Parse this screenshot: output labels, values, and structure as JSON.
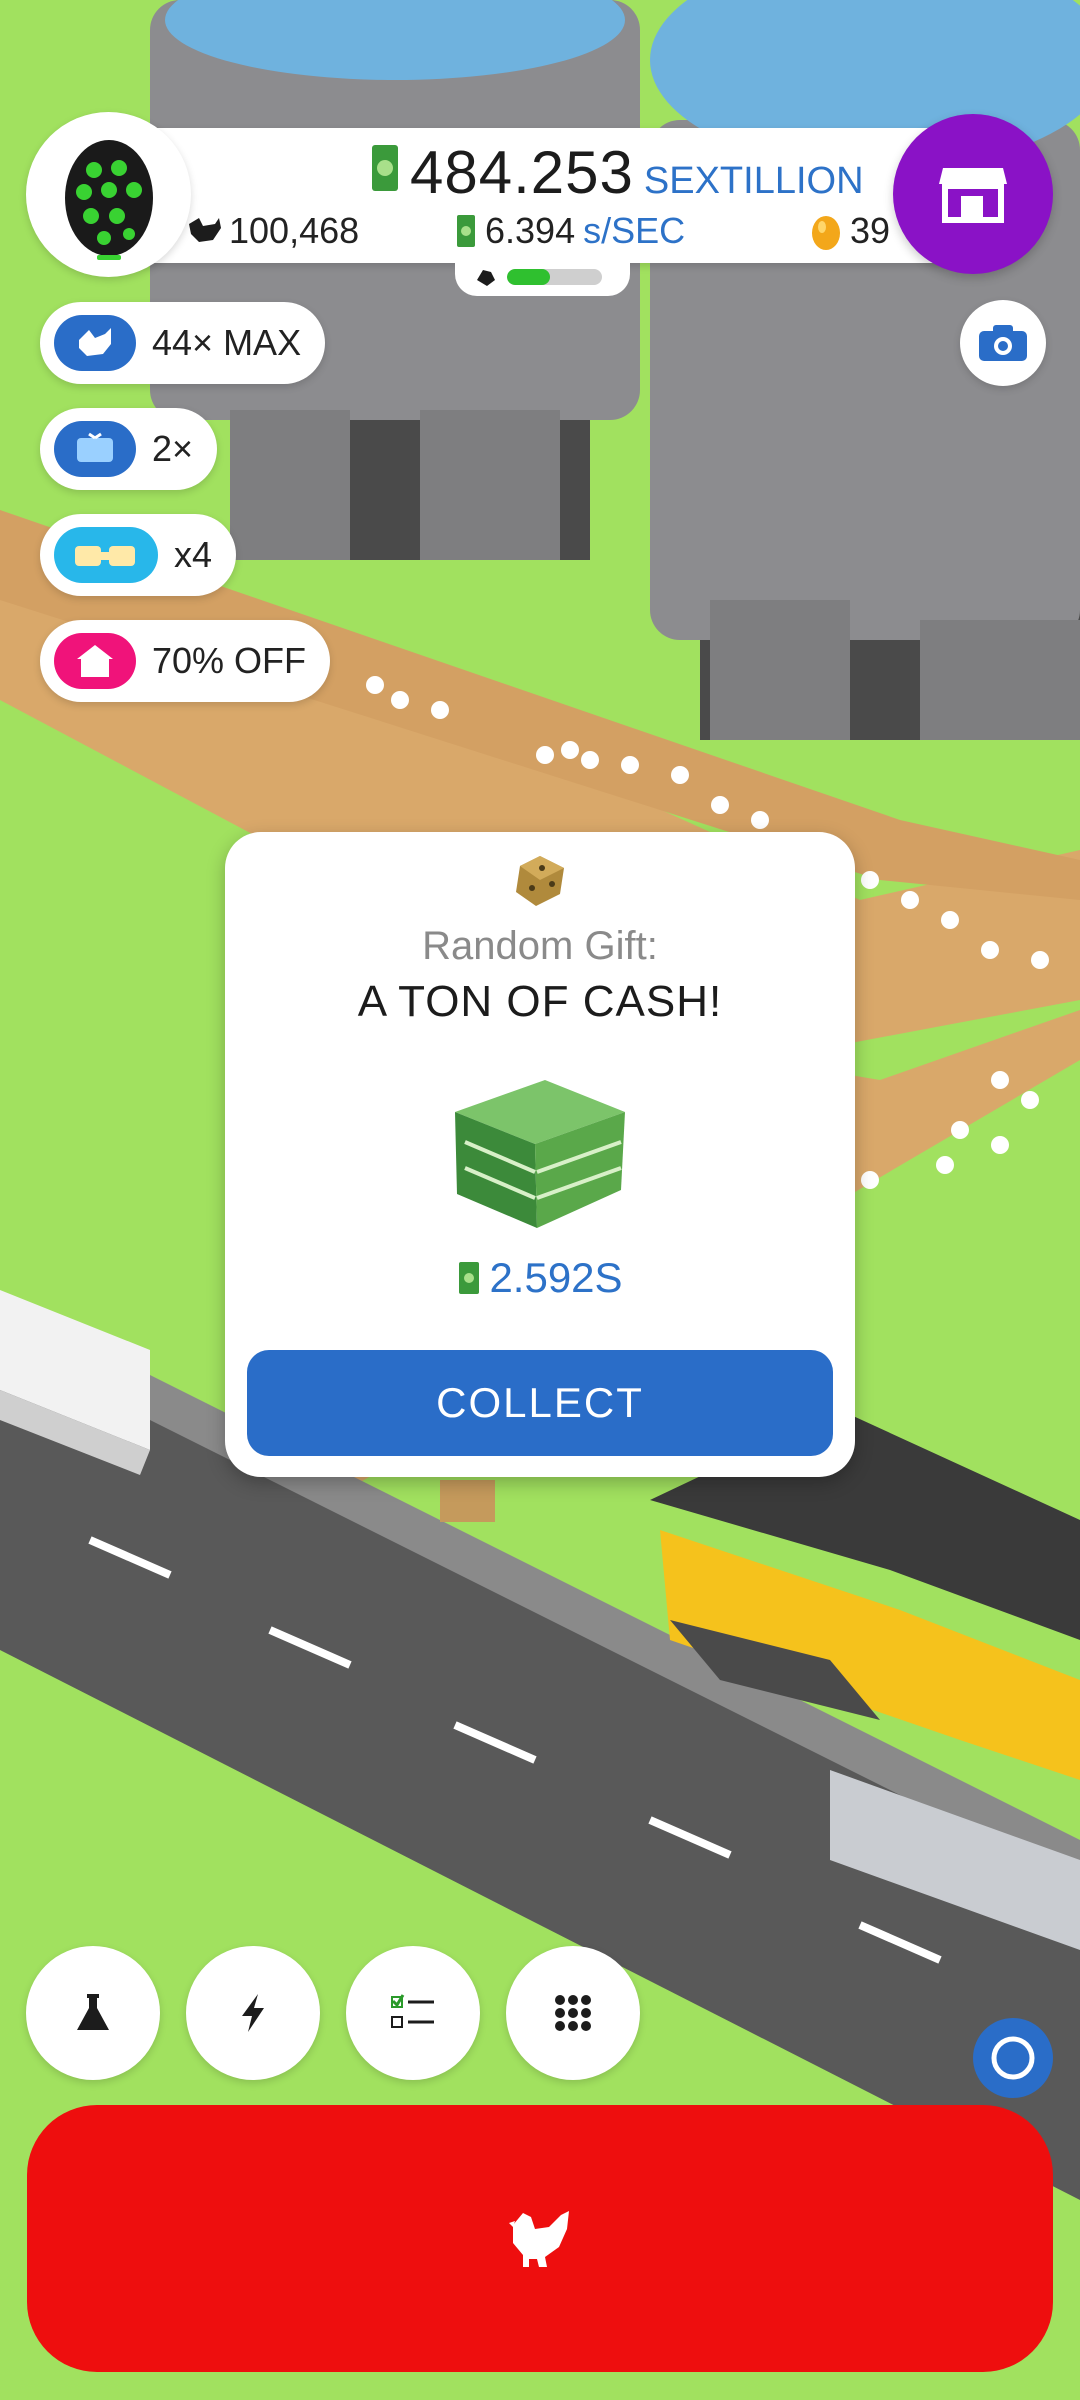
{
  "hud": {
    "cash_value": "484.253",
    "cash_unit": "SEXTILLION",
    "chicken_count": "100,468",
    "rate_value": "6.394",
    "rate_unit": "s/SEC",
    "golden_eggs": "39",
    "hatch_progress": 0.45
  },
  "boosts": [
    {
      "label": "44× MAX",
      "icon": "chicken-icon",
      "color": "#2a6dc8"
    },
    {
      "label": "2×",
      "icon": "tv-icon",
      "color": "#2a6dc8"
    },
    {
      "label": "x4",
      "icon": "drone-icon",
      "color": "#28b7ea"
    },
    {
      "label": "70% OFF",
      "icon": "house-icon",
      "color": "#f0137a"
    }
  ],
  "gift": {
    "label": "Random Gift:",
    "title": "A TON OF CASH!",
    "amount": "2.592S",
    "button": "COLLECT"
  },
  "bottom_nav": [
    "research-icon",
    "boost-icon",
    "missions-icon",
    "menu-grid-icon"
  ],
  "colors": {
    "accent": "#2a6dc8",
    "shop": "#8a12c6",
    "hatch": "#ee0e0e"
  }
}
